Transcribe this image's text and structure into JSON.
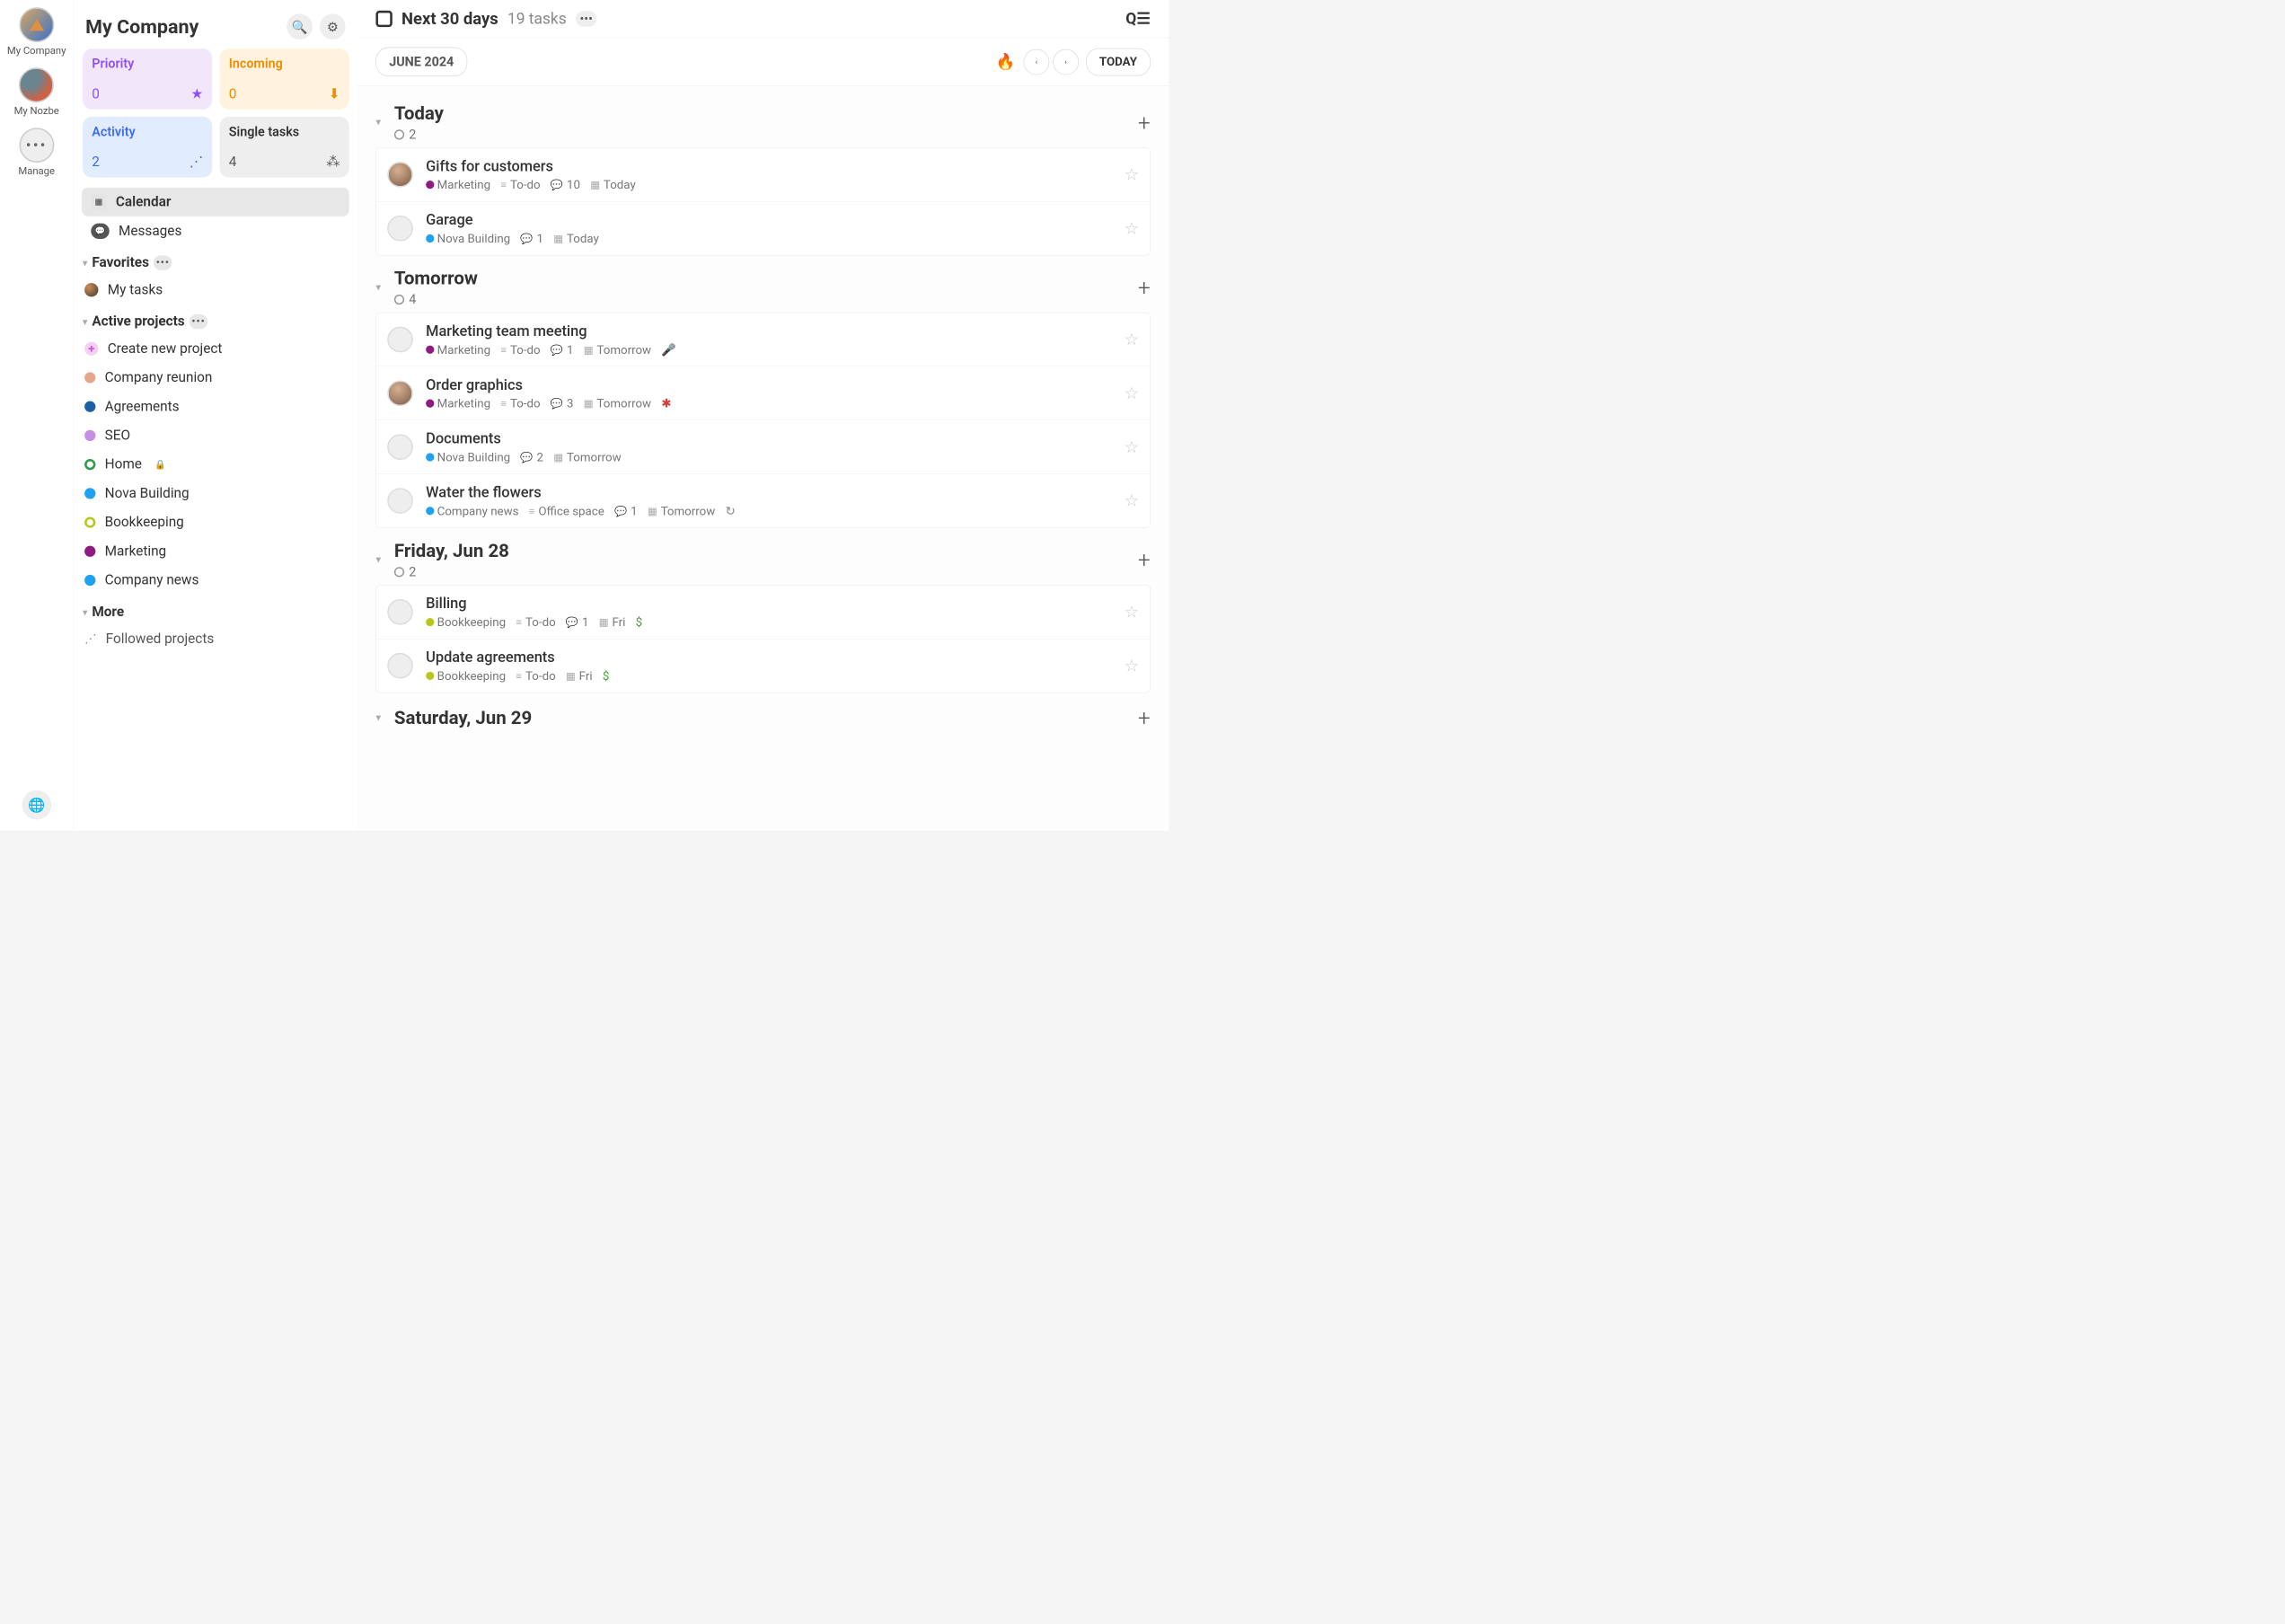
{
  "iconbar": {
    "ws1": "My Company",
    "ws2": "My Nozbe",
    "manage": "Manage"
  },
  "left": {
    "title": "My Company",
    "tiles": {
      "priority": {
        "label": "Priority",
        "count": "0"
      },
      "incoming": {
        "label": "Incoming",
        "count": "0"
      },
      "activity": {
        "label": "Activity",
        "count": "2"
      },
      "single": {
        "label": "Single tasks",
        "count": "4"
      }
    },
    "nav": {
      "calendar": "Calendar",
      "messages": "Messages"
    },
    "favorites": {
      "label": "Favorites",
      "items": [
        "My tasks"
      ]
    },
    "projects": {
      "label": "Active projects",
      "create": "Create new project",
      "list": [
        {
          "name": "Company reunion",
          "color": "#e7a58c"
        },
        {
          "name": "Agreements",
          "color": "#1b5fa7"
        },
        {
          "name": "SEO",
          "color": "#c58ee3"
        },
        {
          "name": "Home",
          "color": "#2e9b4a",
          "ring": true,
          "lock": true
        },
        {
          "name": "Nova Building",
          "color": "#1ea0f3"
        },
        {
          "name": "Bookkeeping",
          "color": "#b7c71d",
          "ring": true
        },
        {
          "name": "Marketing",
          "color": "#8d1b82"
        },
        {
          "name": "Company news",
          "color": "#1ea0f3"
        }
      ]
    },
    "more": {
      "label": "More",
      "items": [
        "Followed projects"
      ]
    }
  },
  "header": {
    "title": "Next 30 days",
    "subtitle": "19 tasks"
  },
  "subheader": {
    "month": "JUNE 2024",
    "today": "TODAY"
  },
  "days": [
    {
      "title": "Today",
      "count": "2",
      "tasks": [
        {
          "title": "Gifts for customers",
          "avatar": "person",
          "project": "Marketing",
          "pcolor": "#8d1b82",
          "section": "To-do",
          "comments": "10",
          "date": "Today"
        },
        {
          "title": "Garage",
          "avatar": "ring",
          "project": "Nova Building",
          "pcolor": "#1ea0f3",
          "comments": "1",
          "date": "Today"
        }
      ]
    },
    {
      "title": "Tomorrow",
      "count": "4",
      "tasks": [
        {
          "title": "Marketing team meeting",
          "avatar": "ring",
          "project": "Marketing",
          "pcolor": "#8d1b82",
          "section": "To-do",
          "comments": "1",
          "date": "Tomorrow",
          "extra": "mic"
        },
        {
          "title": "Order graphics",
          "avatar": "person",
          "project": "Marketing",
          "pcolor": "#8d1b82",
          "section": "To-do",
          "comments": "3",
          "date": "Tomorrow",
          "extra": "alert"
        },
        {
          "title": "Documents",
          "avatar": "ring",
          "project": "Nova Building",
          "pcolor": "#1ea0f3",
          "comments": "2",
          "date": "Tomorrow"
        },
        {
          "title": "Water the flowers",
          "avatar": "ring",
          "project": "Company news",
          "pcolor": "#1ea0f3",
          "section": "Office space",
          "comments": "1",
          "date": "Tomorrow",
          "extra": "repeat"
        }
      ]
    },
    {
      "title": "Friday, Jun 28",
      "count": "2",
      "tasks": [
        {
          "title": "Billing",
          "avatar": "ring",
          "project": "Bookkeeping",
          "pcolor": "#b7c71d",
          "section": "To-do",
          "comments": "1",
          "date": "Fri",
          "extra": "money"
        },
        {
          "title": "Update agreements",
          "avatar": "ring",
          "project": "Bookkeeping",
          "pcolor": "#b7c71d",
          "section": "To-do",
          "date": "Fri",
          "extra": "money"
        }
      ]
    },
    {
      "title": "Saturday, Jun 29",
      "count": "",
      "tasks": []
    }
  ]
}
